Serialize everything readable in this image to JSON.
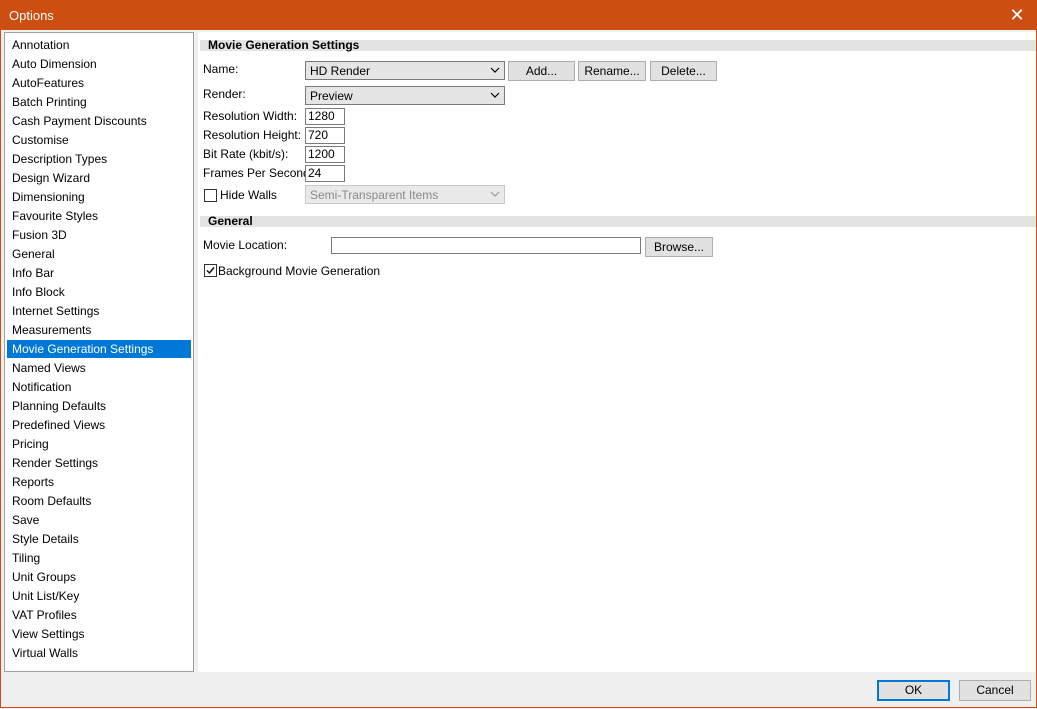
{
  "window": {
    "title": "Options",
    "close_glyph": "✕"
  },
  "sidebar": {
    "selected_index": 16,
    "items": [
      "Annotation",
      "Auto Dimension",
      "AutoFeatures",
      "Batch Printing",
      "Cash Payment Discounts",
      "Customise",
      "Description Types",
      "Design Wizard",
      "Dimensioning",
      "Favourite Styles",
      "Fusion 3D",
      "General",
      "Info Bar",
      "Info Block",
      "Internet Settings",
      "Measurements",
      "Movie Generation Settings",
      "Named Views",
      "Notification",
      "Planning Defaults",
      "Predefined Views",
      "Pricing",
      "Render Settings",
      "Reports",
      "Room Defaults",
      "Save",
      "Style Details",
      "Tiling",
      "Unit Groups",
      "Unit List/Key",
      "VAT Profiles",
      "View Settings",
      "Virtual Walls"
    ]
  },
  "movie": {
    "section_title": "Movie Generation Settings",
    "name_label": "Name:",
    "name_value": "HD Render",
    "add_label": "Add...",
    "rename_label": "Rename...",
    "delete_label": "Delete...",
    "render_label": "Render:",
    "render_value": "Preview",
    "res_width_label": "Resolution Width:",
    "res_width_value": "1280",
    "res_height_label": "Resolution Height:",
    "res_height_value": "720",
    "bitrate_label": "Bit Rate (kbit/s):",
    "bitrate_value": "1200",
    "fps_label": "Frames Per Second:",
    "fps_value": "24",
    "hide_walls_label": "Hide Walls",
    "hide_walls_checked": false,
    "hide_walls_mode": "Semi-Transparent Items"
  },
  "general": {
    "section_title": "General",
    "location_label": "Movie Location:",
    "location_value": "",
    "browse_label": "Browse...",
    "background_label": "Background Movie Generation",
    "background_checked": true
  },
  "footer": {
    "ok_label": "OK",
    "cancel_label": "Cancel"
  },
  "colors": {
    "titlebar": "#cc4e10",
    "selection": "#0078d7"
  }
}
